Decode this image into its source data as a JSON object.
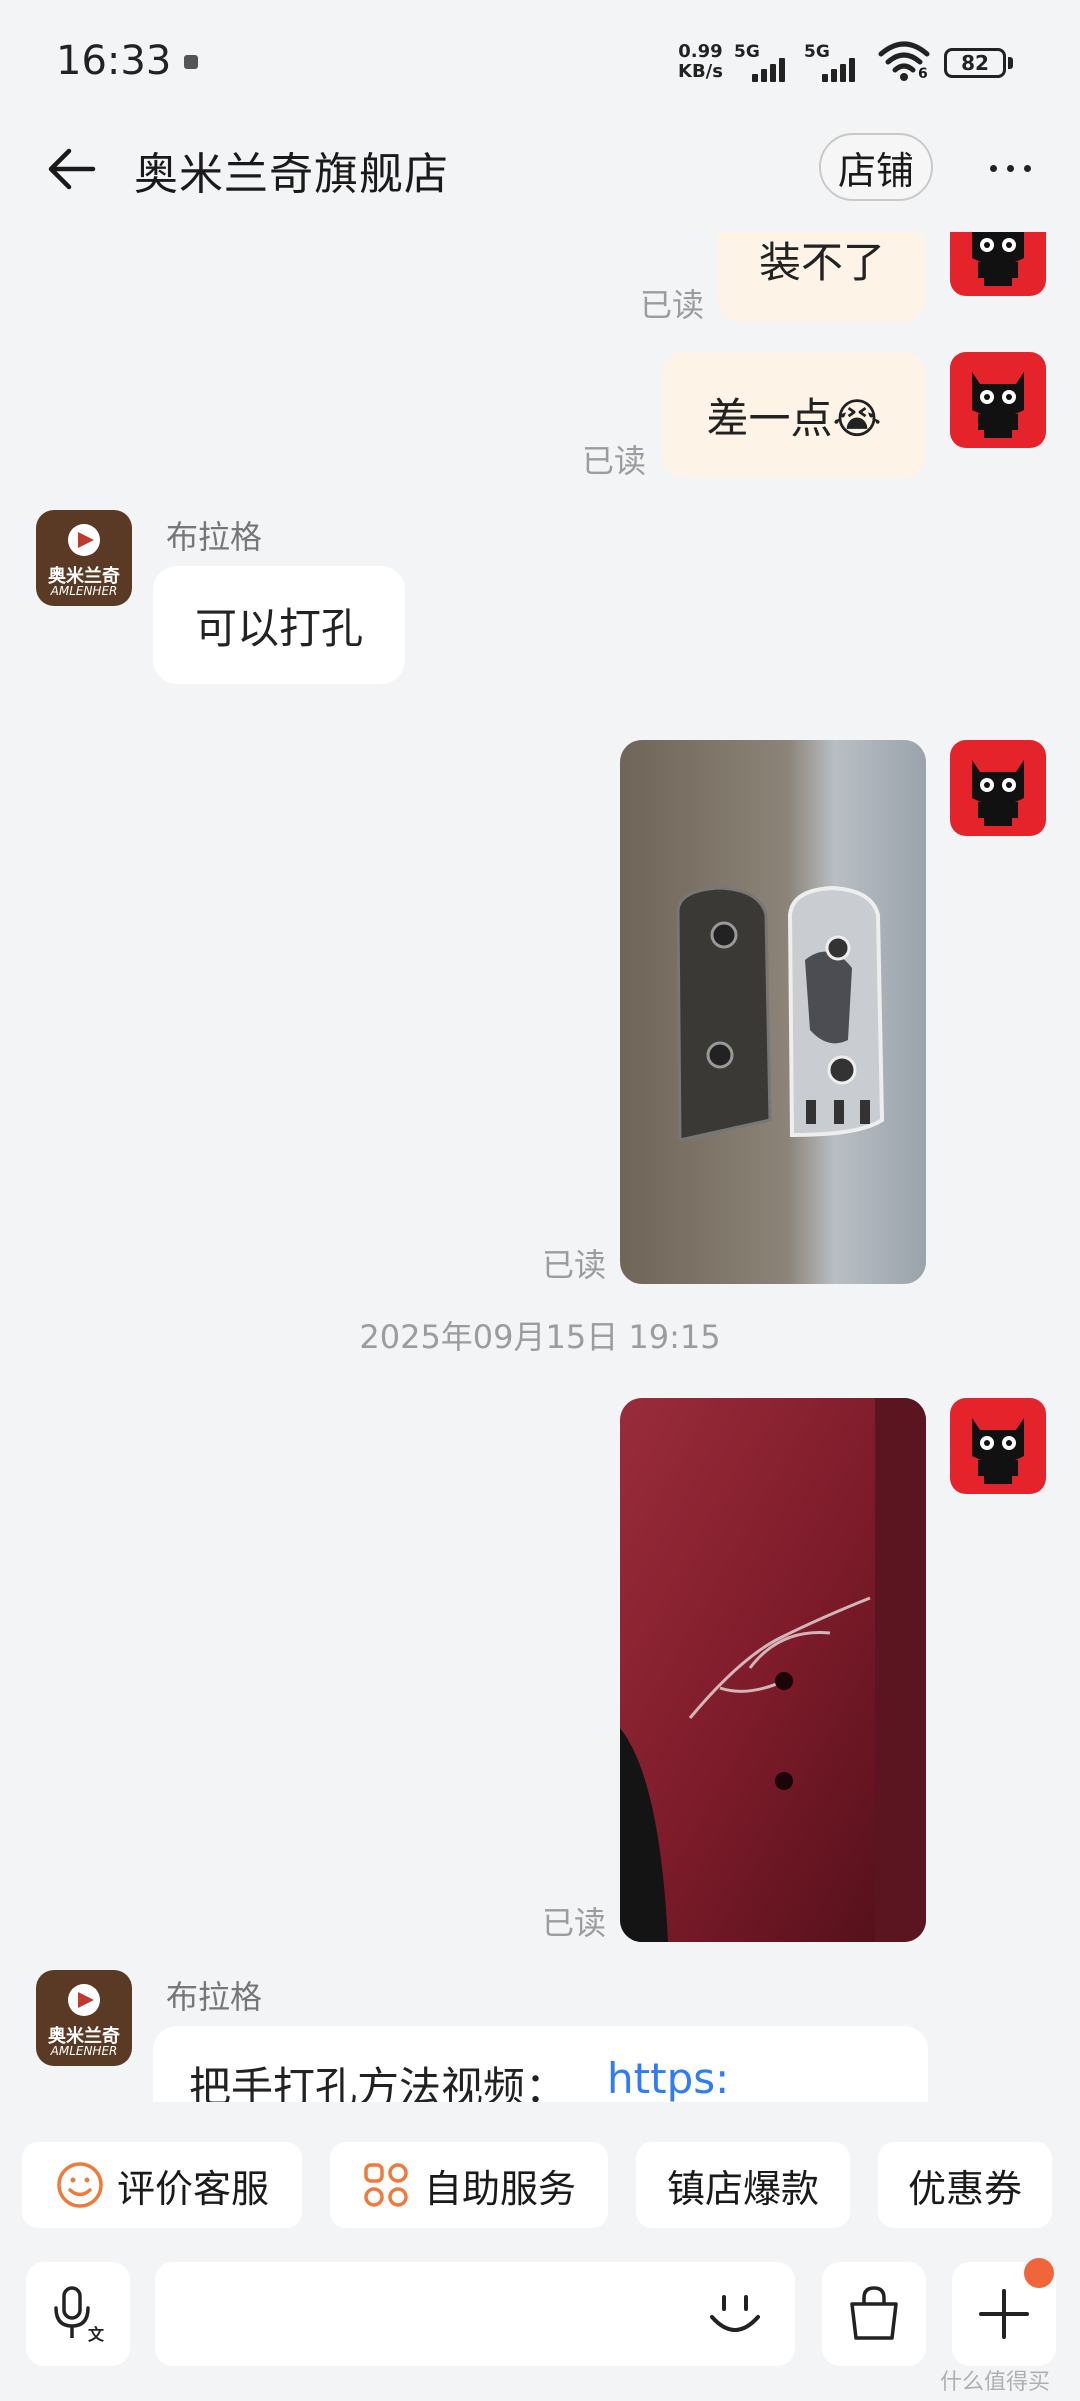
{
  "status_bar": {
    "time": "16:33",
    "net_speed_value": "0.99",
    "net_speed_unit": "KB/s",
    "signal1_label": "5G",
    "signal2_label": "5G",
    "wifi_sub": "6",
    "battery": "82"
  },
  "header": {
    "title": "奥米兰奇旗舰店",
    "shop_button": "店铺"
  },
  "chat": {
    "messages": [
      {
        "text": "装不了",
        "read": "已读"
      },
      {
        "text": "差一点😭",
        "read": "已读"
      },
      {
        "sender": "布拉格",
        "text": "可以打孔"
      },
      {
        "read": "已读"
      },
      {
        "read": "已读"
      },
      {
        "sender": "布拉格",
        "text_prefix": "把手打孔方法视频：",
        "link": "https:"
      }
    ],
    "timestamp": "2025年09月15日 19:15",
    "shop_avatar_text": "奥米兰奇",
    "shop_avatar_sub": "AMLENHER"
  },
  "quick_actions": [
    "评价客服",
    "自助服务",
    "镇店爆款",
    "优惠券"
  ],
  "input": {
    "placeholder": ""
  },
  "watermark": "什么值得买",
  "colors": {
    "background": "#f3f4f6",
    "outgoing_bubble": "#fdf3e6",
    "incoming_bubble": "#ffffff",
    "tmall_red": "#e5232b",
    "link": "#2f7cf6",
    "accent_orange": "#f0653a"
  }
}
